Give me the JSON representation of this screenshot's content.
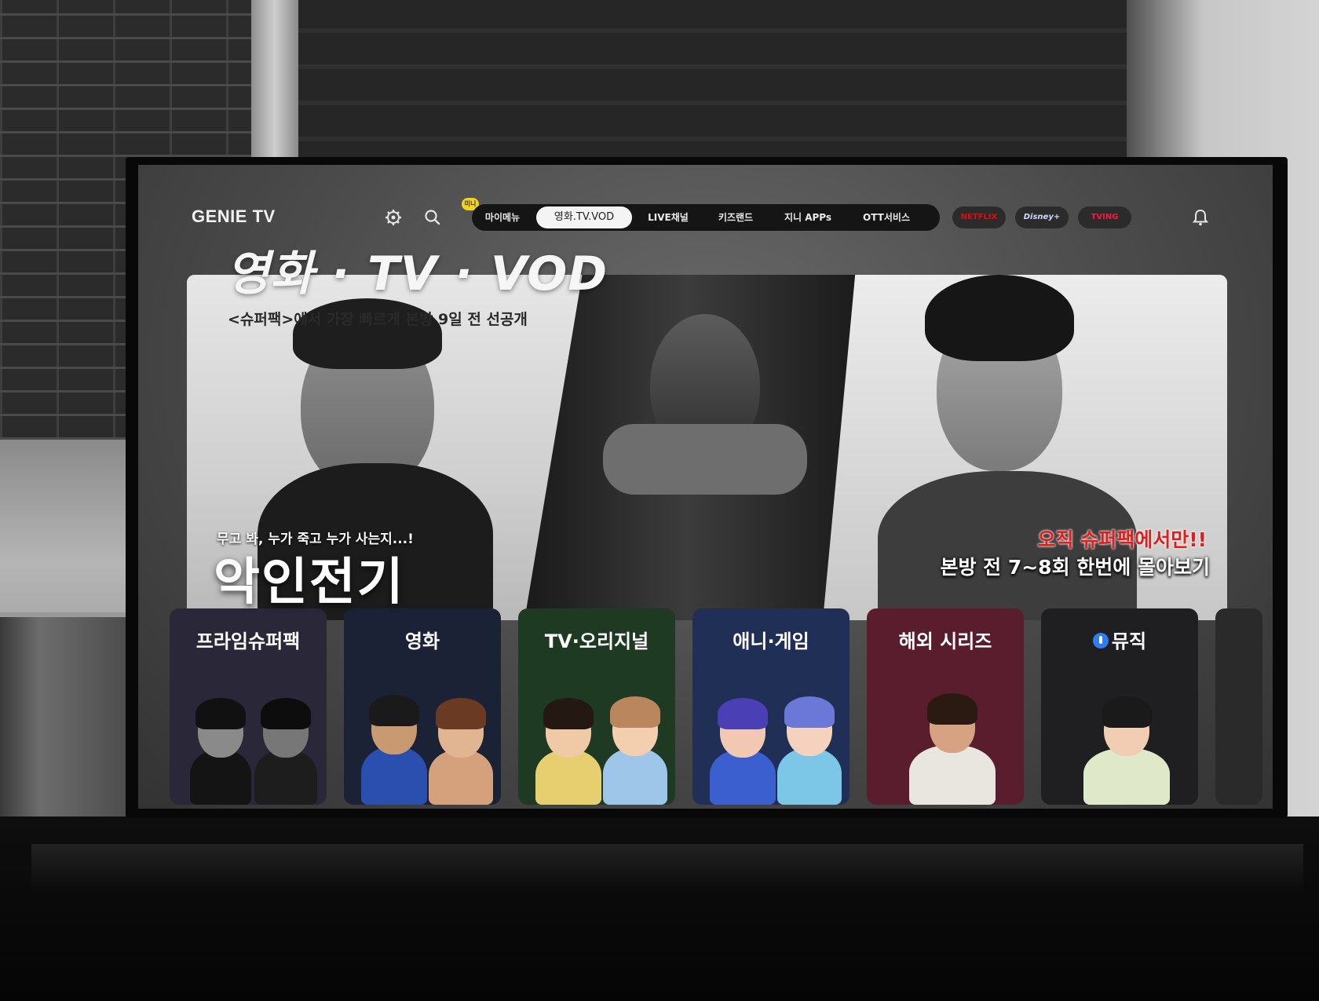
{
  "app": {
    "logo": "GENIE TV"
  },
  "nav": {
    "badge": "미니",
    "items": [
      {
        "label": "마이메뉴",
        "active": false
      },
      {
        "label": "영화.TV.VOD",
        "active": true
      },
      {
        "label": "LIVE채널",
        "active": false
      },
      {
        "label": "키즈랜드",
        "active": false
      },
      {
        "label": "지니 APPs",
        "active": false
      },
      {
        "label": "OTT서비스",
        "active": false
      }
    ],
    "ott": [
      {
        "label": "NETFLIX",
        "color": "#e50914"
      },
      {
        "label": "Disney+",
        "color": "#cfd8ff"
      },
      {
        "label": "TVING",
        "color": "#ff153c"
      }
    ]
  },
  "section": {
    "title": "영화 · TV · VOD"
  },
  "hero": {
    "subtitle": "<슈퍼팩>에서 가장 빠르게 본방 9일 전 선공개",
    "tagline": "무고 봐, 누가 죽고 누가 사는지...!",
    "show_title": "악인전기",
    "promo": "오직 슈퍼팩에서만!!",
    "promo_sub": "본방 전 7~8회 한번에 몰아보기"
  },
  "categories": [
    {
      "label": "프라임슈퍼팩",
      "bg": "#2a2738"
    },
    {
      "label": "영화",
      "bg": "#1c2236"
    },
    {
      "label": "TV·오리지널",
      "bg": "#1f3a23"
    },
    {
      "label": "애니·게임",
      "bg": "#1f2f55"
    },
    {
      "label": "해외 시리즈",
      "bg": "#5a1d2d"
    },
    {
      "label": "뮤직",
      "bg": "#1f1f22"
    }
  ]
}
